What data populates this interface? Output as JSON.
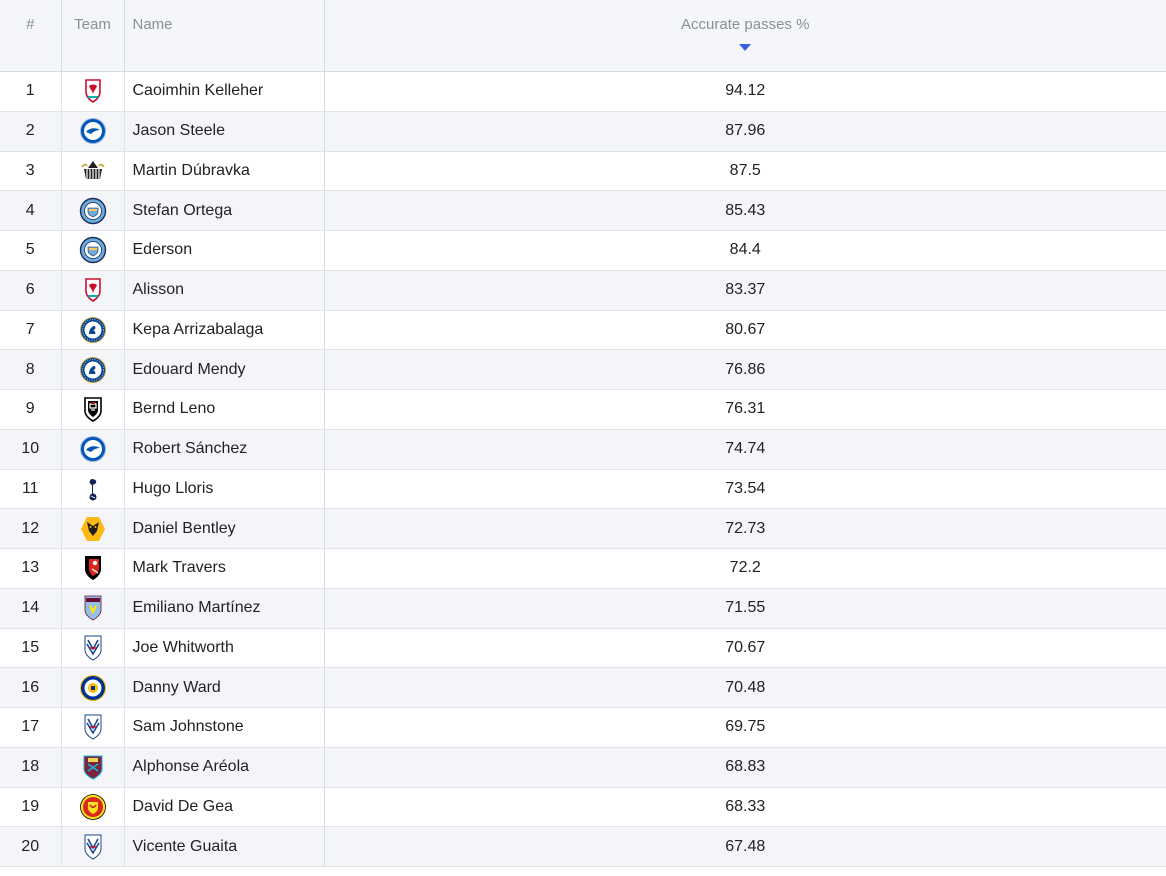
{
  "header": {
    "rank": "#",
    "team": "Team",
    "name": "Name",
    "value": "Accurate passes %"
  },
  "colors": {
    "sort_arrow": "#3d5ce6",
    "header_bg": "#f5f6fa",
    "row_alt_bg": "#f4f5f9"
  },
  "rows": [
    {
      "rank": "1",
      "team_icon": "liverpool-crest-icon",
      "name": "Caoimhin Kelleher",
      "value": "94.12"
    },
    {
      "rank": "2",
      "team_icon": "brighton-crest-icon",
      "name": "Jason Steele",
      "value": "87.96"
    },
    {
      "rank": "3",
      "team_icon": "newcastle-crest-icon",
      "name": "Martin Dúbravka",
      "value": "87.5"
    },
    {
      "rank": "4",
      "team_icon": "man-city-crest-icon",
      "name": "Stefan Ortega",
      "value": "85.43"
    },
    {
      "rank": "5",
      "team_icon": "man-city-crest-icon",
      "name": "Ederson",
      "value": "84.4"
    },
    {
      "rank": "6",
      "team_icon": "liverpool-crest-icon",
      "name": "Alisson",
      "value": "83.37"
    },
    {
      "rank": "7",
      "team_icon": "chelsea-crest-icon",
      "name": "Kepa Arrizabalaga",
      "value": "80.67"
    },
    {
      "rank": "8",
      "team_icon": "chelsea-crest-icon",
      "name": "Edouard Mendy",
      "value": "76.86"
    },
    {
      "rank": "9",
      "team_icon": "fulham-crest-icon",
      "name": "Bernd Leno",
      "value": "76.31"
    },
    {
      "rank": "10",
      "team_icon": "brighton-crest-icon",
      "name": "Robert Sánchez",
      "value": "74.74"
    },
    {
      "rank": "11",
      "team_icon": "tottenham-crest-icon",
      "name": "Hugo Lloris",
      "value": "73.54"
    },
    {
      "rank": "12",
      "team_icon": "wolves-crest-icon",
      "name": "Daniel Bentley",
      "value": "72.73"
    },
    {
      "rank": "13",
      "team_icon": "bournemouth-crest-icon",
      "name": "Mark Travers",
      "value": "72.2"
    },
    {
      "rank": "14",
      "team_icon": "aston-villa-crest-icon",
      "name": "Emiliano Martínez",
      "value": "71.55"
    },
    {
      "rank": "15",
      "team_icon": "crystal-palace-crest-icon",
      "name": "Joe Whitworth",
      "value": "70.67"
    },
    {
      "rank": "16",
      "team_icon": "leicester-crest-icon",
      "name": "Danny Ward",
      "value": "70.48"
    },
    {
      "rank": "17",
      "team_icon": "crystal-palace-crest-icon",
      "name": "Sam Johnstone",
      "value": "69.75"
    },
    {
      "rank": "18",
      "team_icon": "west-ham-crest-icon",
      "name": "Alphonse Aréola",
      "value": "68.83"
    },
    {
      "rank": "19",
      "team_icon": "man-united-crest-icon",
      "name": "David De Gea",
      "value": "68.33"
    },
    {
      "rank": "20",
      "team_icon": "crystal-palace-crest-icon",
      "name": "Vicente Guaita",
      "value": "67.48"
    }
  ]
}
